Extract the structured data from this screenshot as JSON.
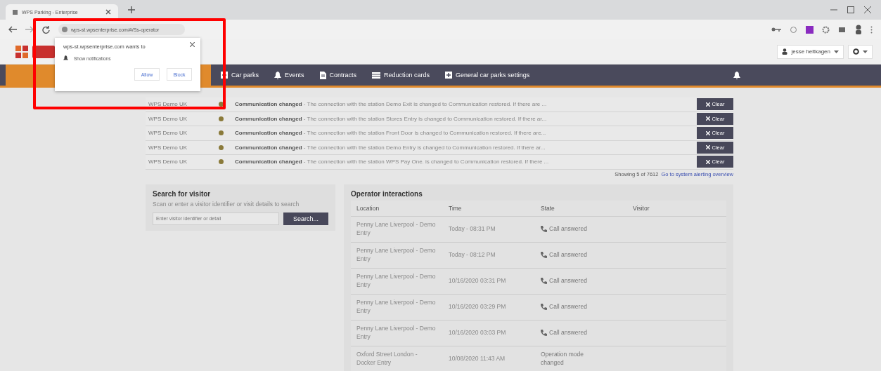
{
  "browser": {
    "tab_title": "WPS Parking - Enterprise",
    "url": "wps-st.wpsenterprise.com/#/Ss-operator"
  },
  "header": {
    "user": "jesse heltkagen"
  },
  "nav": {
    "items": [
      {
        "label": "Car parks",
        "kind": "square"
      },
      {
        "label": "Events",
        "kind": "bell"
      },
      {
        "label": "Contracts",
        "kind": "doc"
      },
      {
        "label": "Reduction cards",
        "kind": "card"
      },
      {
        "label": "General car parks settings",
        "kind": "square"
      }
    ]
  },
  "alerts": {
    "rows": [
      {
        "site": "WPS Demo UK",
        "message": "**Communication changed** - The connection with the station Demo Exit is changed to Communication restored. If there are ...",
        "button": "Clear"
      },
      {
        "site": "WPS Demo UK",
        "message": "**Communication changed** - The connection with the station Stores Entry is changed to Communication restored. If there ar...",
        "button": "Clear"
      },
      {
        "site": "WPS Demo UK",
        "message": "**Communication changed** - The connection with the station Front Door is changed to Communication restored. If there are...",
        "button": "Clear"
      },
      {
        "site": "WPS Demo UK",
        "message": "**Communication changed** - The connection with the station Demo Entry is changed to Communication restored. If there ar...",
        "button": "Clear"
      },
      {
        "site": "WPS Demo UK",
        "message": "**Communication changed** - The connection with the station WPS Pay One. is changed to Communication restored. If there ...",
        "button": "Clear"
      }
    ],
    "summary": "Showing 5 of 7612",
    "link": "Go to system alerting overview"
  },
  "search": {
    "title": "Search for visitor",
    "hint": "Scan or enter a visitor identifier or visit details to search",
    "placeholder": "Enter visitor identifier or detail",
    "button": "Search..."
  },
  "interactions": {
    "title": "Operator interactions",
    "columns": [
      "Location",
      "Time",
      "State",
      "Visitor"
    ],
    "rows": [
      {
        "location": "Penny Lane Liverpool - Demo Entry",
        "time": "Today - 08:31 PM",
        "state": "Call answered",
        "kind": "call"
      },
      {
        "location": "Penny Lane Liverpool - Demo Entry",
        "time": "Today - 08:12 PM",
        "state": "Call answered",
        "kind": "call"
      },
      {
        "location": "Penny Lane Liverpool - Demo Entry",
        "time": "10/16/2020 03:31 PM",
        "state": "Call answered",
        "kind": "call"
      },
      {
        "location": "Penny Lane Liverpool - Demo Entry",
        "time": "10/16/2020 03:29 PM",
        "state": "Call answered",
        "kind": "call"
      },
      {
        "location": "Penny Lane Liverpool - Demo Entry",
        "time": "10/16/2020 03:03 PM",
        "state": "Call answered",
        "kind": "call"
      },
      {
        "location": "Oxford Street London - Docker Entry",
        "time": "10/08/2020 11:43 AM",
        "state": "Operation mode changed",
        "kind": "mode"
      }
    ]
  },
  "popup": {
    "title": "wps-st.wpsenterprise.com wants to",
    "permission": "Show notifications",
    "buttons": [
      "Allow",
      "Block"
    ]
  },
  "highlight": {
    "shown": true
  }
}
